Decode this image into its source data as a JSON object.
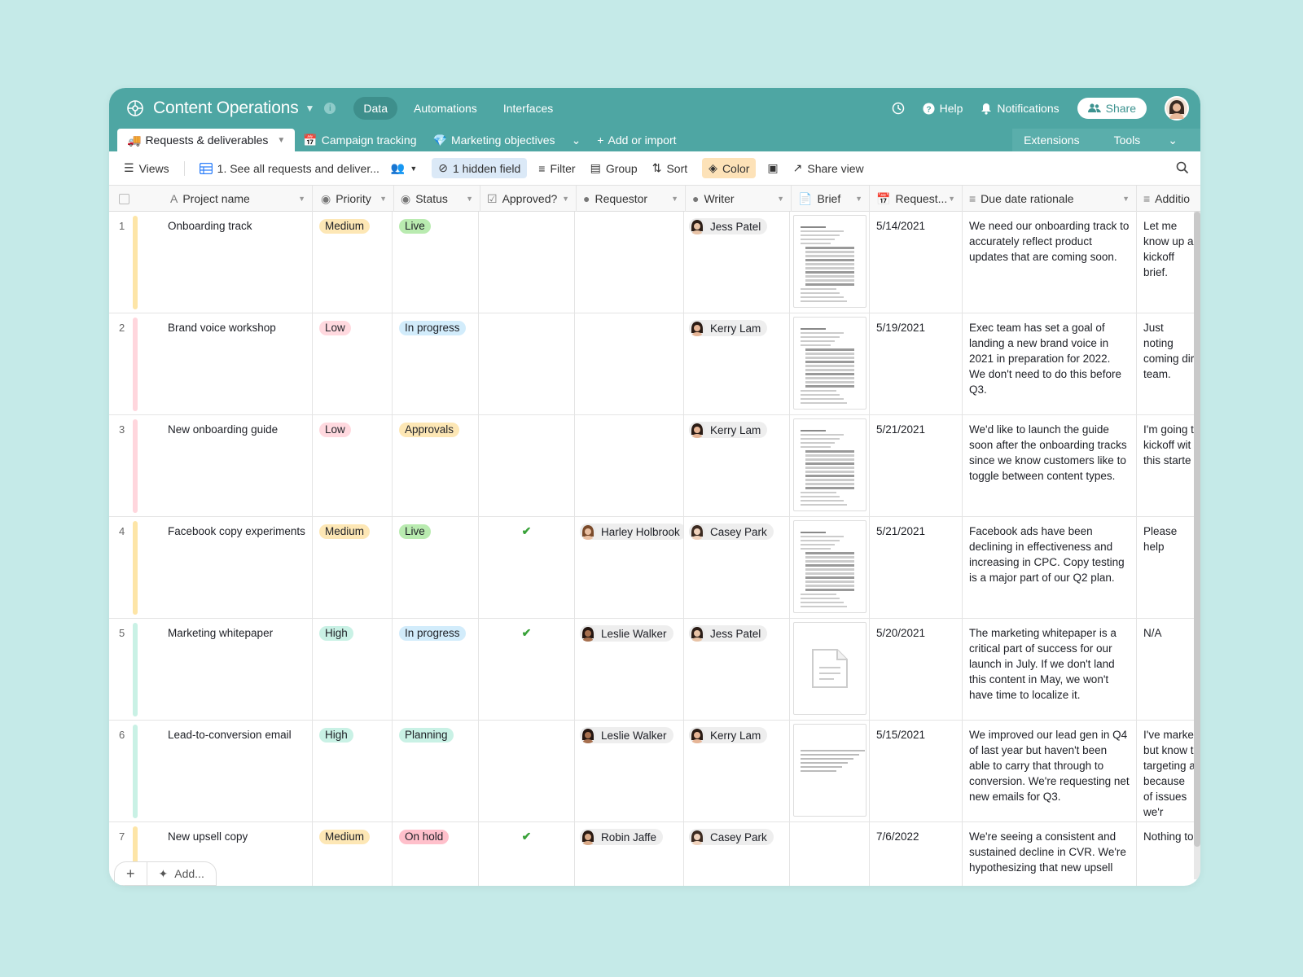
{
  "app": {
    "title": "Content Operations",
    "nav": [
      "Data",
      "Automations",
      "Interfaces"
    ],
    "help": "Help",
    "notifications": "Notifications",
    "share": "Share"
  },
  "tabs": {
    "items": [
      {
        "icon": "🚚",
        "label": "Requests & deliverables"
      },
      {
        "icon": "📅",
        "label": "Campaign tracking"
      },
      {
        "icon": "💎",
        "label": "Marketing objectives"
      }
    ],
    "add": "Add or import",
    "extensions": "Extensions",
    "tools": "Tools"
  },
  "toolbar": {
    "views": "Views",
    "view_name": "1. See all requests and deliver...",
    "hidden": "1 hidden field",
    "filter": "Filter",
    "group": "Group",
    "sort": "Sort",
    "color": "Color",
    "share_view": "Share view"
  },
  "columns": [
    "Project name",
    "Priority",
    "Status",
    "Approved?",
    "Requestor",
    "Writer",
    "Brief",
    "Request...",
    "Due date rationale",
    "Additio"
  ],
  "colors": {
    "header": "#4ea6a3",
    "medium": "#fde7b5",
    "low": "#ffd9df",
    "high": "#c9f1e5",
    "live": "#b9ebb0",
    "in_progress": "#d2ecfb",
    "approvals": "#fde7b5",
    "planning": "#c9f1e5",
    "on_hold": "#ffc0cb"
  },
  "rows": [
    {
      "num": "1",
      "name": "Onboarding track",
      "priority": "Medium",
      "pcolor": "#fde7b5",
      "status": "Live",
      "scolor": "#b9ebb0",
      "approved": "",
      "requestor": "",
      "writer": "Jess Patel",
      "brief": "doc",
      "date": "5/14/2021",
      "rationale": "We need our onboarding track to accurately reflect product updates that are coming soon.",
      "additional": "Let me know up a kickoff brief.",
      "bar": "#fde5a7"
    },
    {
      "num": "2",
      "name": "Brand voice workshop",
      "priority": "Low",
      "pcolor": "#ffd9df",
      "status": "In progress",
      "scolor": "#d2ecfb",
      "approved": "",
      "requestor": "",
      "writer": "Kerry Lam",
      "brief": "doc",
      "date": "5/19/2021",
      "rationale": "Exec team has set a goal of landing a new brand voice in 2021 in preparation for 2022. We don't need to do this before Q3.",
      "additional": "Just noting coming dir team.",
      "bar": "#ffd6dd"
    },
    {
      "num": "3",
      "name": "New onboarding guide",
      "priority": "Low",
      "pcolor": "#ffd9df",
      "status": "Approvals",
      "scolor": "#fde7b5",
      "approved": "",
      "requestor": "",
      "writer": "Kerry Lam",
      "brief": "doc",
      "date": "5/21/2021",
      "rationale": "We'd like to launch the guide soon after the onboarding tracks since we know customers like to toggle between content types.",
      "additional": "I'm going t kickoff wit this starte",
      "bar": "#ffd6dd"
    },
    {
      "num": "4",
      "name": "Facebook copy experiments",
      "priority": "Medium",
      "pcolor": "#fde7b5",
      "status": "Live",
      "scolor": "#b9ebb0",
      "approved": "✔",
      "requestor": "Harley Holbrook",
      "writer": "Casey Park",
      "brief": "doc",
      "date": "5/21/2021",
      "rationale": "Facebook ads have been declining in effectiveness and increasing in CPC. Copy testing is a major part of our Q2 plan.",
      "additional": "Please help",
      "bar": "#fde5a7"
    },
    {
      "num": "5",
      "name": "Marketing whitepaper",
      "priority": "High",
      "pcolor": "#c9f1e5",
      "status": "In progress",
      "scolor": "#d2ecfb",
      "approved": "✔",
      "requestor": "Leslie Walker",
      "writer": "Jess Patel",
      "brief": "file",
      "date": "5/20/2021",
      "rationale": "The marketing whitepaper is a critical part of success for our launch in July. If we don't land this content in May, we won't have time to localize it.",
      "additional": "N/A",
      "bar": "#c9f1e5"
    },
    {
      "num": "6",
      "name": "Lead-to-conversion email",
      "priority": "High",
      "pcolor": "#c9f1e5",
      "status": "Planning",
      "scolor": "#c9f1e5",
      "approved": "",
      "requestor": "Leslie Walker",
      "writer": "Kerry Lam",
      "brief": "email",
      "date": "5/15/2021",
      "rationale": "We improved our lead gen in Q4 of last year but haven't been able to carry that through to conversion. We're requesting net new emails for Q3.",
      "additional": "I've marke but know t targeting a because of issues we'r",
      "bar": "#c9f1e5"
    },
    {
      "num": "7",
      "name": "New upsell copy",
      "priority": "Medium",
      "pcolor": "#fde7b5",
      "status": "On hold",
      "scolor": "#ffc0cb",
      "approved": "✔",
      "requestor": "Robin Jaffe",
      "writer": "Casey Park",
      "brief": "",
      "date": "7/6/2022",
      "rationale": "We're seeing a consistent and sustained decline in CVR. We're hypothesizing that new upsell",
      "additional": "Nothing to",
      "bar": "#fde5a7"
    }
  ],
  "footer": {
    "add": "Add..."
  }
}
